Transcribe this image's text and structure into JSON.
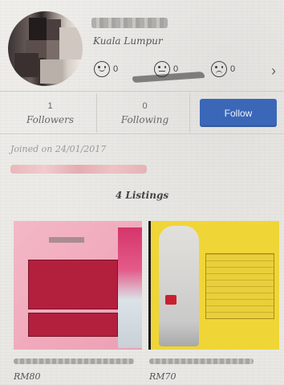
{
  "profile": {
    "location": "Kuala Lumpur",
    "ratings": [
      {
        "icon": "happy-face-icon",
        "count": "0"
      },
      {
        "icon": "neutral-face-icon",
        "count": "0"
      },
      {
        "icon": "sad-face-icon",
        "count": "0"
      }
    ],
    "more_icon": "chevron-right-icon"
  },
  "stats": {
    "followers_count": "1",
    "followers_label": "Followers",
    "following_count": "0",
    "following_label": "Following",
    "follow_button": "Follow"
  },
  "joined": "Joined on 24/01/2017",
  "listings": {
    "title": "4 Listings",
    "items": [
      {
        "price": "RM80"
      },
      {
        "price": "RM70"
      }
    ]
  },
  "colors": {
    "accent": "#3b67b8",
    "card1_bg": "#f0a8bb",
    "card2_bg": "#f0d536"
  }
}
